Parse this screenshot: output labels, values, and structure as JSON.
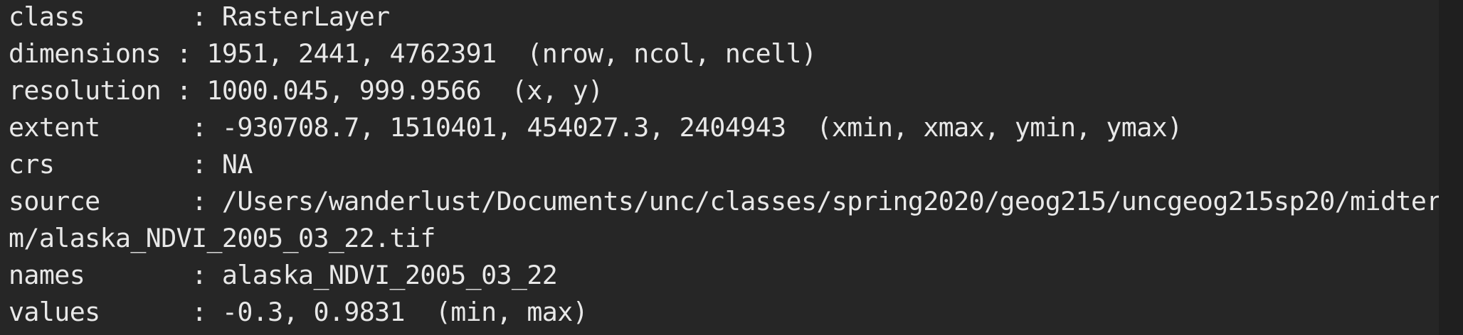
{
  "console": {
    "lines": [
      "class       : RasterLayer",
      "dimensions : 1951, 2441, 4762391  (nrow, ncol, ncell)",
      "resolution : 1000.045, 999.9566  (x, y)",
      "extent      : -930708.7, 1510401, 454027.3, 2404943  (xmin, xmax, ymin, ymax)",
      "crs         : NA",
      "source      : /Users/wanderlust/Documents/unc/classes/spring2020/geog215/uncgeog215sp20/midter",
      "m/alaska_NDVI_2005_03_22.tif",
      "names       : alaska_NDVI_2005_03_22",
      "values      : -0.3, 0.9831  (min, max)"
    ]
  }
}
